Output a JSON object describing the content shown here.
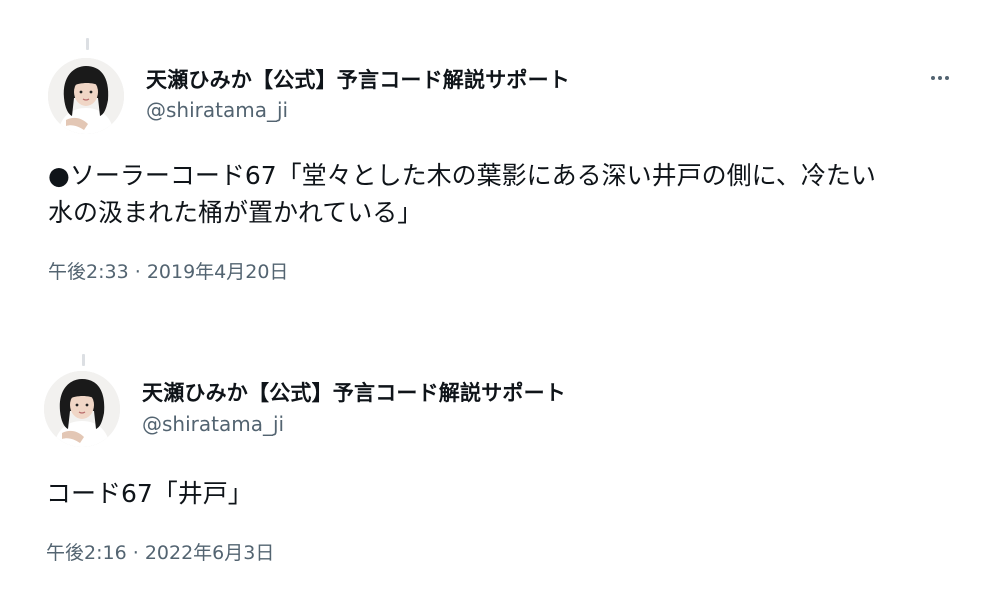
{
  "tweets": [
    {
      "author": {
        "display_name": "天瀬ひみか【公式】予言コード解説サポート",
        "handle": "@shiratama_ji",
        "avatar_icon": "user-avatar-photo"
      },
      "text": "●ソーラーコード67「堂々とした木の葉影にある深い井戸の側に、冷たい\n水の汲まれた桶が置かれている」",
      "time": "午後2:33",
      "separator": "·",
      "date": "2019年4月20日",
      "more_icon": "more-horizontal-icon"
    },
    {
      "author": {
        "display_name": "天瀬ひみか【公式】予言コード解説サポート",
        "handle": "@shiratama_ji",
        "avatar_icon": "user-avatar-photo"
      },
      "text": "コード67「井戸」",
      "time": "午後2:16",
      "separator": "·",
      "date": "2022年6月3日"
    }
  ],
  "colors": {
    "text_primary": "#0f1419",
    "text_secondary": "#536471",
    "thread_line": "#dcdfe3",
    "background": "#ffffff"
  }
}
